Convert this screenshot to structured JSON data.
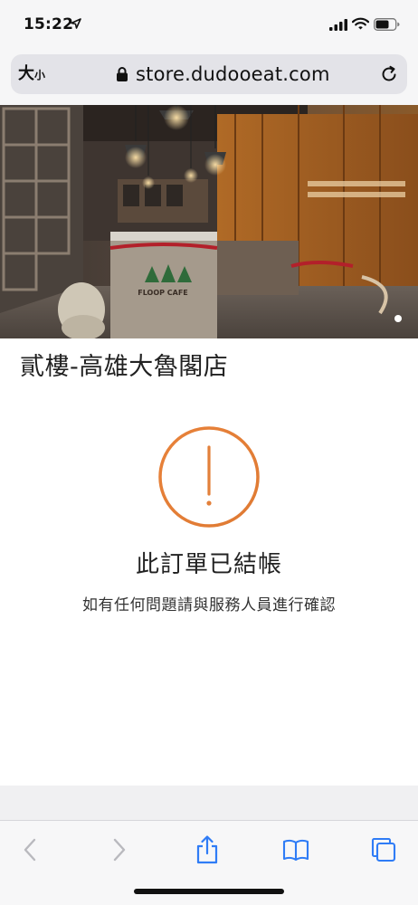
{
  "status_bar": {
    "time": "15:22"
  },
  "url_bar": {
    "text_size_big": "大",
    "text_size_small": "小",
    "url": "store.dudooeat.com"
  },
  "hero": {
    "sign_text": "FLOOP CAFE"
  },
  "store": {
    "name": "貳樓-高雄大魯閣店"
  },
  "order_status": {
    "title": "此訂單已結帳",
    "message": "如有任何問題請與服務人員進行確認",
    "accent_color": "#e3803a"
  },
  "toolbar": {
    "back_icon": "chevron-left-icon",
    "forward_icon": "chevron-right-icon",
    "share_icon": "share-icon",
    "bookmarks_icon": "book-icon",
    "tabs_icon": "tabs-icon"
  }
}
